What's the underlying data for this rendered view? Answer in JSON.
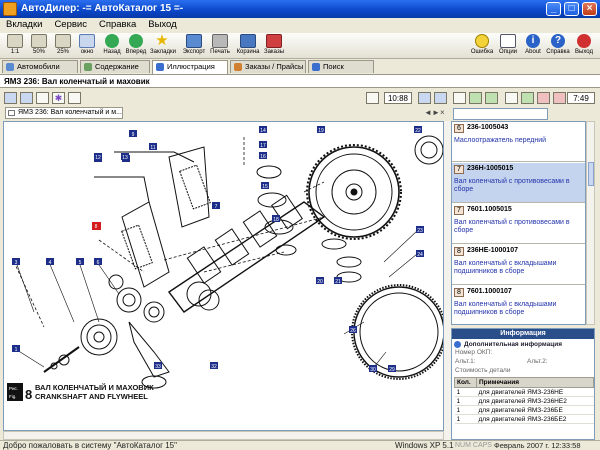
{
  "window": {
    "title": "АвтоДилер: -= АвтоКаталог 15 =-",
    "minimize": "_",
    "maximize": "□",
    "close": "×"
  },
  "menu": [
    "Вкладки",
    "Сервис",
    "Справка",
    "Выход"
  ],
  "toolbar": {
    "left": [
      {
        "label": "1:1",
        "icon": "zoom-1to1-icon"
      },
      {
        "label": "50%",
        "icon": "zoom-50-icon"
      },
      {
        "label": "25%",
        "icon": "zoom-25-icon"
      },
      {
        "label": "окно",
        "icon": "zoom-fit-icon"
      },
      {
        "label": "Назад",
        "icon": "back-icon"
      },
      {
        "label": "Вперед",
        "icon": "forward-icon"
      },
      {
        "label": "Закладки",
        "icon": "bookmarks-icon"
      },
      {
        "label": "Экспорт",
        "icon": "export-icon"
      },
      {
        "label": "Печать",
        "icon": "print-icon"
      },
      {
        "label": "Корзина",
        "icon": "cart-icon"
      },
      {
        "label": "Заказы",
        "icon": "orders-icon"
      }
    ],
    "right": [
      {
        "label": "Ошибка",
        "icon": "error-smiley-icon"
      },
      {
        "label": "Опции",
        "icon": "options-icon"
      },
      {
        "label": "About",
        "icon": "about-icon"
      },
      {
        "label": "Справка",
        "icon": "help-icon"
      },
      {
        "label": "Выход",
        "icon": "exit-icon"
      }
    ]
  },
  "tabs": [
    {
      "label": "Автомобили",
      "active": false
    },
    {
      "label": "Содержание",
      "active": false
    },
    {
      "label": "Иллюстрация",
      "active": true
    },
    {
      "label": "Заказы / Прайсы",
      "active": false
    },
    {
      "label": "Поиск",
      "active": false
    }
  ],
  "breadcrumb": "ЯМЗ 236: Вал коленчатый и маховик",
  "left_time": "10:88",
  "right_time": "7:49",
  "doc_tab": "ЯМЗ 236: Вал коленчатый и м...",
  "doc_nav": [
    "◄",
    "►",
    "×"
  ],
  "figure": {
    "prefix_top": "Рис.",
    "prefix_bottom": "Fig.",
    "number": "8",
    "title_ru": "ВАЛ КОЛЕНЧАТЫЙ И МАХОВИК",
    "title_en": "CRANKSHAFT AND FLYWHEEL",
    "callouts": [
      "1",
      "2",
      "3",
      "4",
      "5",
      "6",
      "7",
      "8",
      "9",
      "10",
      "11",
      "12",
      "13",
      "14",
      "15",
      "16",
      "17",
      "18",
      "19",
      "20",
      "21",
      "22",
      "23",
      "24",
      "25",
      "26",
      "27",
      "28",
      "29",
      "30",
      "31",
      "32",
      "33"
    ]
  },
  "parts": [
    {
      "qty": "6",
      "code": "236-1005043",
      "desc": "Маслоотражатель передний",
      "selected": false
    },
    {
      "qty": "7",
      "code": "236Н-1005015",
      "desc": "Вал коленчатый с противовесами в сборе",
      "selected": true
    },
    {
      "qty": "7",
      "code": "7601.1005015",
      "desc": "Вал коленчатый с противовесами в сборе",
      "selected": false
    },
    {
      "qty": "8",
      "code": "236НЕ-1000107",
      "desc": "Вал коленчатый с вкладышами подшипников в сборе",
      "selected": false
    },
    {
      "qty": "8",
      "code": "7601.1000107",
      "desc": "Вал коленчатый с вкладышами подшипников в сборе",
      "selected": false
    }
  ],
  "info": {
    "header": "Информация",
    "subheader": "Дополнительная информация",
    "okp_label": "Номер ОКП:",
    "alt1_label": "Альт.1:",
    "alt2_label": "Альт.2:",
    "cost_label": "Стоимость детали",
    "columns": [
      "Кол.",
      "Примечания"
    ],
    "rows": [
      {
        "qty": "1",
        "note": "для двигателей ЯМЗ-236НЕ"
      },
      {
        "qty": "1",
        "note": "для двигателей ЯМЗ-236НЕ2"
      },
      {
        "qty": "1",
        "note": "для двигателей ЯМЗ-236БЕ"
      },
      {
        "qty": "1",
        "note": "для двигателей ЯМЗ-236БЕ2"
      }
    ]
  },
  "status": {
    "message": "Добро пожаловать в систему \"АвтоКаталог 15\"",
    "os": "Windows XP 5.1",
    "indicators": "NUM CAPS",
    "datetime": "Февраль 2007 г. 12:33:58"
  },
  "colors": {
    "title_bar": "#0a46c8",
    "selection": "#c5d4ee",
    "callout": "#1c2d8a",
    "info_header": "#294e8a"
  }
}
